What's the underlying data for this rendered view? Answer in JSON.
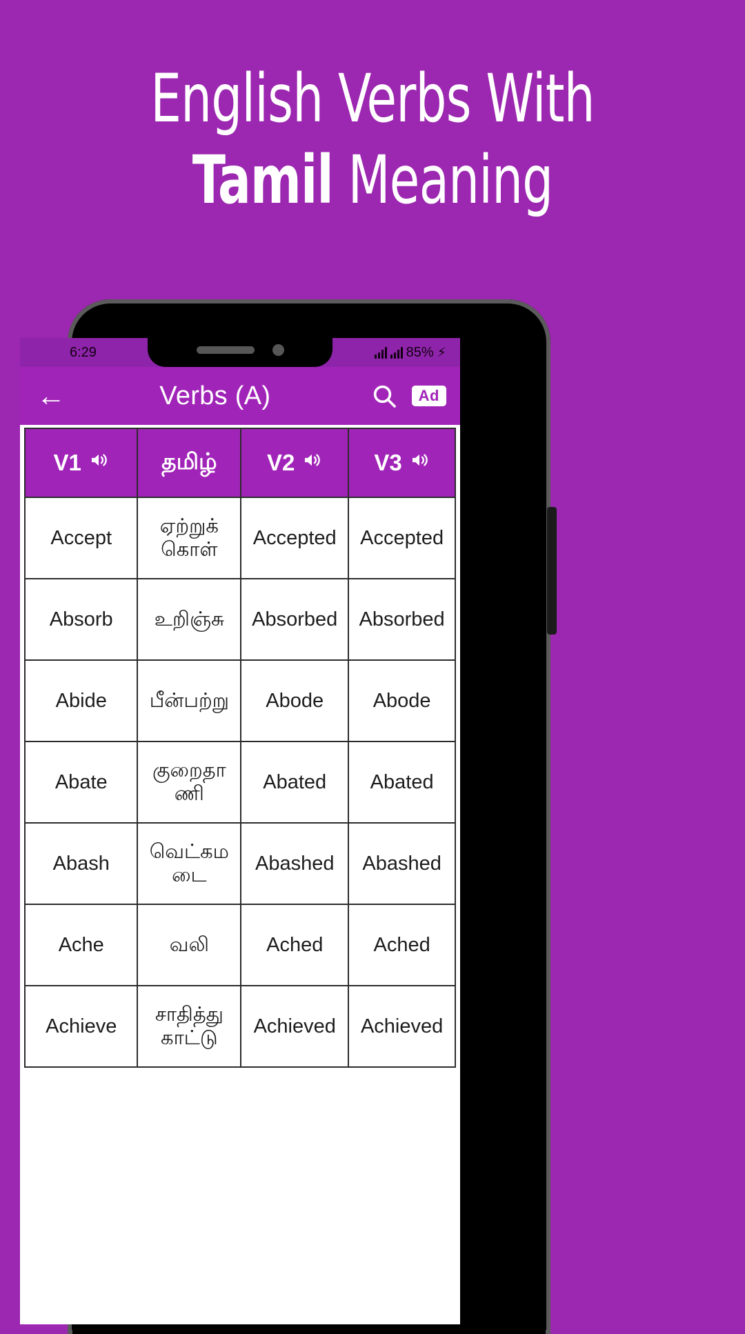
{
  "promo": {
    "line1": "English Verbs With",
    "line2_bold": "Tamil",
    "line2_rest": " Meaning",
    "background_color": "#9C27B0",
    "text_color": "#FFFFFF"
  },
  "device": {
    "status_bar": {
      "time": "6:29",
      "battery_percent": "85%",
      "charging_icon": "bolt-icon",
      "signal_icon": "signal-bars-icon",
      "background_color": "#8E24AA"
    }
  },
  "app": {
    "appbar": {
      "back_icon": "back-arrow-icon",
      "title": "Verbs (A)",
      "search_icon": "search-icon",
      "ad_label": "Ad",
      "background_color": "#A124B8"
    },
    "table": {
      "headers": [
        {
          "label": "V1",
          "speaker": true
        },
        {
          "label": "தமிழ்",
          "speaker": false
        },
        {
          "label": "V2",
          "speaker": true
        },
        {
          "label": "V3",
          "speaker": true
        }
      ],
      "rows": [
        {
          "v1": "Accept",
          "tamil": "ஏற்றுக் கொள்",
          "v2": "Accepted",
          "v3": "Accepted"
        },
        {
          "v1": "Absorb",
          "tamil": "உறிஞ்சு",
          "v2": "Absorbed",
          "v3": "Absorbed"
        },
        {
          "v1": "Abide",
          "tamil": "பீன்பற்று",
          "v2": "Abode",
          "v3": "Abode"
        },
        {
          "v1": "Abate",
          "tamil": "குறைதாணி",
          "v2": "Abated",
          "v3": "Abated"
        },
        {
          "v1": "Abash",
          "tamil": "வெட்கமடை",
          "v2": "Abashed",
          "v3": "Abashed"
        },
        {
          "v1": "Ache",
          "tamil": "வலி",
          "v2": "Ached",
          "v3": "Ached"
        },
        {
          "v1": "Achieve",
          "tamil": "சாதித்து காட்டு",
          "v2": "Achieved",
          "v3": "Achieved"
        }
      ]
    }
  }
}
